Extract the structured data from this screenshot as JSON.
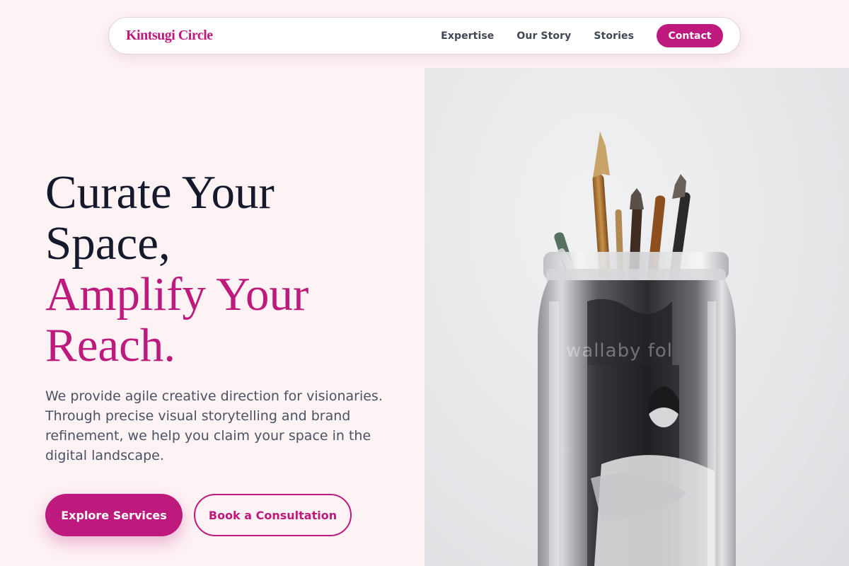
{
  "brand": {
    "name": "Kintsugi Circle"
  },
  "nav": {
    "links": [
      {
        "label": "Expertise"
      },
      {
        "label": "Our Story"
      },
      {
        "label": "Stories"
      }
    ],
    "contact_label": "Contact"
  },
  "hero": {
    "title_line1": "Curate Your",
    "title_line2": "Space,",
    "title_accent_line1": "Amplify Your",
    "title_accent_line2": "Reach.",
    "description": "We provide agile creative direction for visionaries. Through precise visual storytelling and brand refinement, we help you claim your space in the digital landscape.",
    "primary_cta": "Explore Services",
    "secondary_cta": "Book a Consultation",
    "image_watermark": "wallaby fol"
  },
  "colors": {
    "accent": "#be1a7e",
    "background": "#fdf2f4",
    "heading": "#141a2c",
    "body_text": "#4a5263"
  }
}
